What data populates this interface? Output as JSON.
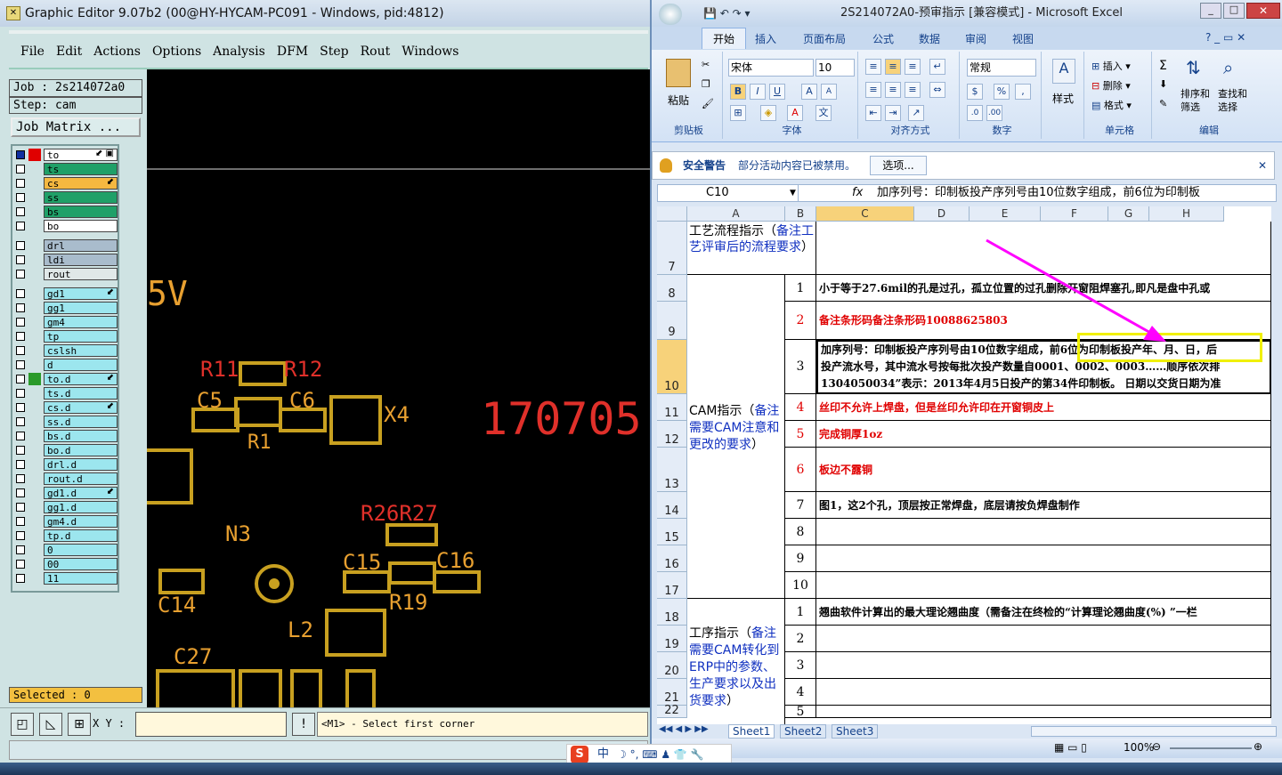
{
  "left_app": {
    "title": "Graphic Editor 9.07b2 (00@HY-HYCAM-PC091 - Windows, pid:4812)",
    "menu": [
      "File",
      "Edit",
      "Actions",
      "Options",
      "Analysis",
      "DFM",
      "Step",
      "Rout",
      "Windows"
    ],
    "job_label": "Job : 2s214072a0",
    "step_label": "Step: cam",
    "job_matrix_button": "Job Matrix ...",
    "layers": [
      {
        "name": "to",
        "color": "#ffffff",
        "status": "#e00000",
        "flag": "⬋ ▣"
      },
      {
        "name": "ts",
        "color": "#1fa068",
        "status": "",
        "flag": ""
      },
      {
        "name": "cs",
        "color": "#f5b840",
        "status": "",
        "flag": "⬋"
      },
      {
        "name": "ss",
        "color": "#1fa068",
        "status": "",
        "flag": ""
      },
      {
        "name": "bs",
        "color": "#1fa068",
        "status": "",
        "flag": ""
      },
      {
        "name": "bo",
        "color": "#ffffff",
        "status": "",
        "flag": ""
      },
      {
        "name": "drl",
        "color": "#a9bccc",
        "status": "",
        "flag": ""
      },
      {
        "name": "ldi",
        "color": "#a9bccc",
        "status": "",
        "flag": ""
      },
      {
        "name": "rout",
        "color": "#e0e8e8",
        "status": "",
        "flag": ""
      },
      {
        "name": "gd1",
        "color": "#9ce6ee",
        "status": "",
        "flag": "⬋"
      },
      {
        "name": "gg1",
        "color": "#9ce6ee",
        "status": "",
        "flag": ""
      },
      {
        "name": "gm4",
        "color": "#9ce6ee",
        "status": "",
        "flag": ""
      },
      {
        "name": "tp",
        "color": "#9ce6ee",
        "status": "",
        "flag": ""
      },
      {
        "name": "cslsh",
        "color": "#9ce6ee",
        "status": "",
        "flag": ""
      },
      {
        "name": "d",
        "color": "#9ce6ee",
        "status": "",
        "flag": ""
      },
      {
        "name": "to.d",
        "color": "#9ce6ee",
        "status": "#2a9a2a",
        "flag": "⬋"
      },
      {
        "name": "ts.d",
        "color": "#9ce6ee",
        "status": "",
        "flag": ""
      },
      {
        "name": "cs.d",
        "color": "#9ce6ee",
        "status": "",
        "flag": "⬋"
      },
      {
        "name": "ss.d",
        "color": "#9ce6ee",
        "status": "",
        "flag": ""
      },
      {
        "name": "bs.d",
        "color": "#9ce6ee",
        "status": "",
        "flag": ""
      },
      {
        "name": "bo.d",
        "color": "#9ce6ee",
        "status": "",
        "flag": ""
      },
      {
        "name": "drl.d",
        "color": "#9ce6ee",
        "status": "",
        "flag": ""
      },
      {
        "name": "rout.d",
        "color": "#9ce6ee",
        "status": "",
        "flag": ""
      },
      {
        "name": "gd1.d",
        "color": "#9ce6ee",
        "status": "",
        "flag": "⬋"
      },
      {
        "name": "gg1.d",
        "color": "#9ce6ee",
        "status": "",
        "flag": ""
      },
      {
        "name": "gm4.d",
        "color": "#9ce6ee",
        "status": "",
        "flag": ""
      },
      {
        "name": "tp.d",
        "color": "#9ce6ee",
        "status": "",
        "flag": ""
      },
      {
        "name": "0",
        "color": "#9ce6ee",
        "status": "",
        "flag": ""
      },
      {
        "name": "00",
        "color": "#9ce6ee",
        "status": "",
        "flag": ""
      },
      {
        "name": "11",
        "color": "#9ce6ee",
        "status": "",
        "flag": ""
      }
    ],
    "selected": "Selected : 0",
    "xy_label": "X Y :",
    "message": "<M1> - Select first corner",
    "canvas_labels": {
      "v5": "5V",
      "r11": "R11",
      "r12": "R12",
      "c5": "C5",
      "c6": "C6",
      "x4": "X4",
      "r1": "R1",
      "date_code": "170705",
      "r26r27": "R26R27",
      "n3": "N3",
      "c15": "C15",
      "c16": "C16",
      "c14": "C14",
      "r19": "R19",
      "l2": "L2",
      "c27": "C27"
    }
  },
  "excel": {
    "title": "2S214072A0-预审指示 [兼容模式] - Microsoft Excel",
    "tabs": [
      "开始",
      "插入",
      "页面布局",
      "公式",
      "数据",
      "审阅",
      "视图"
    ],
    "ribbon": {
      "paste": "粘贴",
      "clipboard": "剪贴板",
      "font_name": "宋体",
      "font_size": "10",
      "font_group": "字体",
      "align_group": "对齐方式",
      "number_format": "常规",
      "number_group": "数字",
      "style": "样式",
      "insert": "插入",
      "delete": "删除",
      "format": "格式",
      "cells_group": "单元格",
      "sort": "排序和\n筛选",
      "find": "查找和\n选择",
      "edit_group": "编辑",
      "sigma": "Σ"
    },
    "security_warning": "安全警告",
    "security_text": "部分活动内容已被禁用。",
    "options_button": "选项...",
    "name_box": "C10",
    "formula": "加序列号：印制板投产序列号由10位数字组成，前6位为印制板",
    "columns": [
      "A",
      "B",
      "C",
      "D",
      "E",
      "F",
      "G",
      "H"
    ],
    "row_numbers": [
      "7",
      "8",
      "9",
      "10",
      "11",
      "12",
      "13",
      "14",
      "15",
      "16",
      "17",
      "18",
      "19",
      "20",
      "21",
      "22"
    ],
    "section_a1": {
      "black": "工艺流程指示（",
      "blue": "备注工艺评审后的流程要求",
      "end": "）"
    },
    "section_a2": {
      "black": "CAM指示（",
      "blue": "备注需要CAM注意和更改的要求",
      "end": "）"
    },
    "section_a3": {
      "black": "工序指示（",
      "blue": "备注需要CAM转化到ERP中的参数、生产要求以及出货要求",
      "end": "）"
    },
    "items": [
      {
        "n": "1",
        "text": "小于等于27.6mil的孔是过孔，孤立位置的过孔删除开窗阻焊塞孔,即凡是盘中孔或",
        "red": false
      },
      {
        "n": "2",
        "text": "备注条形码备注条形码10088625803",
        "red": true
      },
      {
        "n": "3",
        "text": "加序列号：印制板投产序列号由10位数字组成，前6位为印制板投产年、月、日，后",
        "line2": "投产流水号，其中流水号按每批次投产数量自0001、0002、0003……顺序依次排",
        "line3": "1304050034”表示：2013年4月5日投产的第34件印制板。 日期以交货日期为准",
        "red": false
      },
      {
        "n": "4",
        "text": "丝印不允许上焊盘，但是丝印允许印在开窗铜皮上",
        "red": true
      },
      {
        "n": "5",
        "text": "完成铜厚1oz",
        "red": true
      },
      {
        "n": "6",
        "text": "板边不露铜",
        "red": true
      },
      {
        "n": "7",
        "text": "图1，这2个孔，顶层按正常焊盘，底层请按负焊盘制作",
        "red": false
      },
      {
        "n": "8",
        "text": "",
        "red": false
      },
      {
        "n": "9",
        "text": "",
        "red": false
      },
      {
        "n": "10",
        "text": "",
        "red": false
      }
    ],
    "items2": [
      {
        "n": "1",
        "text": "翘曲软件计算出的最大理论翘曲度（需备注在终检的“计算理论翘曲度(%) ”一栏"
      },
      {
        "n": "2",
        "text": ""
      },
      {
        "n": "3",
        "text": ""
      },
      {
        "n": "4",
        "text": ""
      },
      {
        "n": "5",
        "text": ""
      }
    ],
    "sheets": [
      "Sheet1",
      "Sheet2",
      "Sheet3"
    ],
    "zoom": "100%",
    "annotation_color": "#ff00ff"
  },
  "ime": {
    "lang": "中"
  }
}
